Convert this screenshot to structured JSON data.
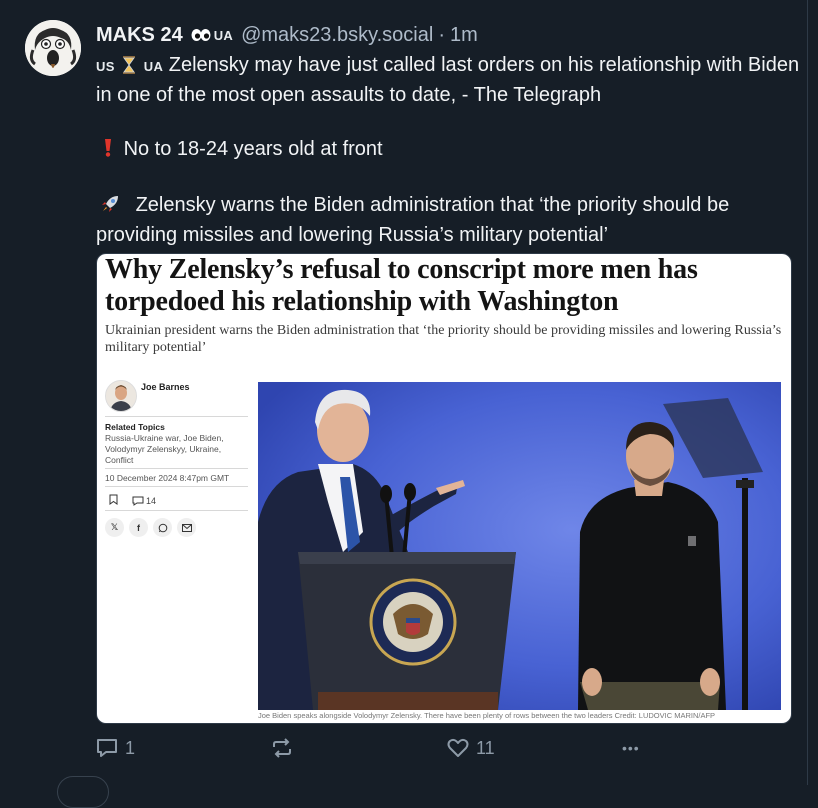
{
  "post": {
    "author_name": "MAKS 24",
    "flag_tag": "UA",
    "handle": "@maks23.bsky.social",
    "separator": "·",
    "time": "1m",
    "text_line1_prefix_left": "US",
    "text_line1_prefix_right": "UA",
    "text_para1": "Zelensky may have just called last orders on his relationship with Biden in one of the most open assaults to date, - The Telegraph",
    "text_para2": "No to 18-24 years old at front",
    "text_para3": "Zelensky warns the Biden administration that ‘the priority should be providing missiles and lowering Russia’s military potential’"
  },
  "card": {
    "headline": "Why Zelensky’s refusal to conscript more men has torpedoed his relationship with Washington",
    "standfirst": "Ukrainian president warns the Biden administration that ‘the priority should be providing missiles and lowering Russia’s military potential’",
    "author": "Joe Barnes",
    "related_topics_heading": "Related Topics",
    "related_topics": "Russia-Ukraine war, Joe Biden, Volodymyr Zelenskyy, Ukraine, Conflict",
    "date": "10 December 2024 8:47pm GMT",
    "comment_count": "14",
    "caption": "Joe Biden speaks alongside Volodymyr Zelensky. There have been plenty of rows between the two leaders  Credit: LUDOVIC MARIN/AFP"
  },
  "actions": {
    "reply_count": "1",
    "repost_count": "",
    "like_count": "11",
    "more_label": "•••"
  },
  "colors": {
    "background": "#161e27",
    "text": "#f1f3f5",
    "muted": "#8d9aa7",
    "handle": "#aebbc9",
    "photo_backdrop": "#3c55c8"
  },
  "icons": [
    "avatar-eyes-icon",
    "hourglass-icon",
    "exclamation-icon",
    "rocket-icon",
    "reply-icon",
    "repost-icon",
    "like-icon",
    "more-icon",
    "bookmark-icon",
    "comment-icon",
    "x-share-icon",
    "facebook-share-icon",
    "whatsapp-share-icon",
    "email-share-icon"
  ]
}
